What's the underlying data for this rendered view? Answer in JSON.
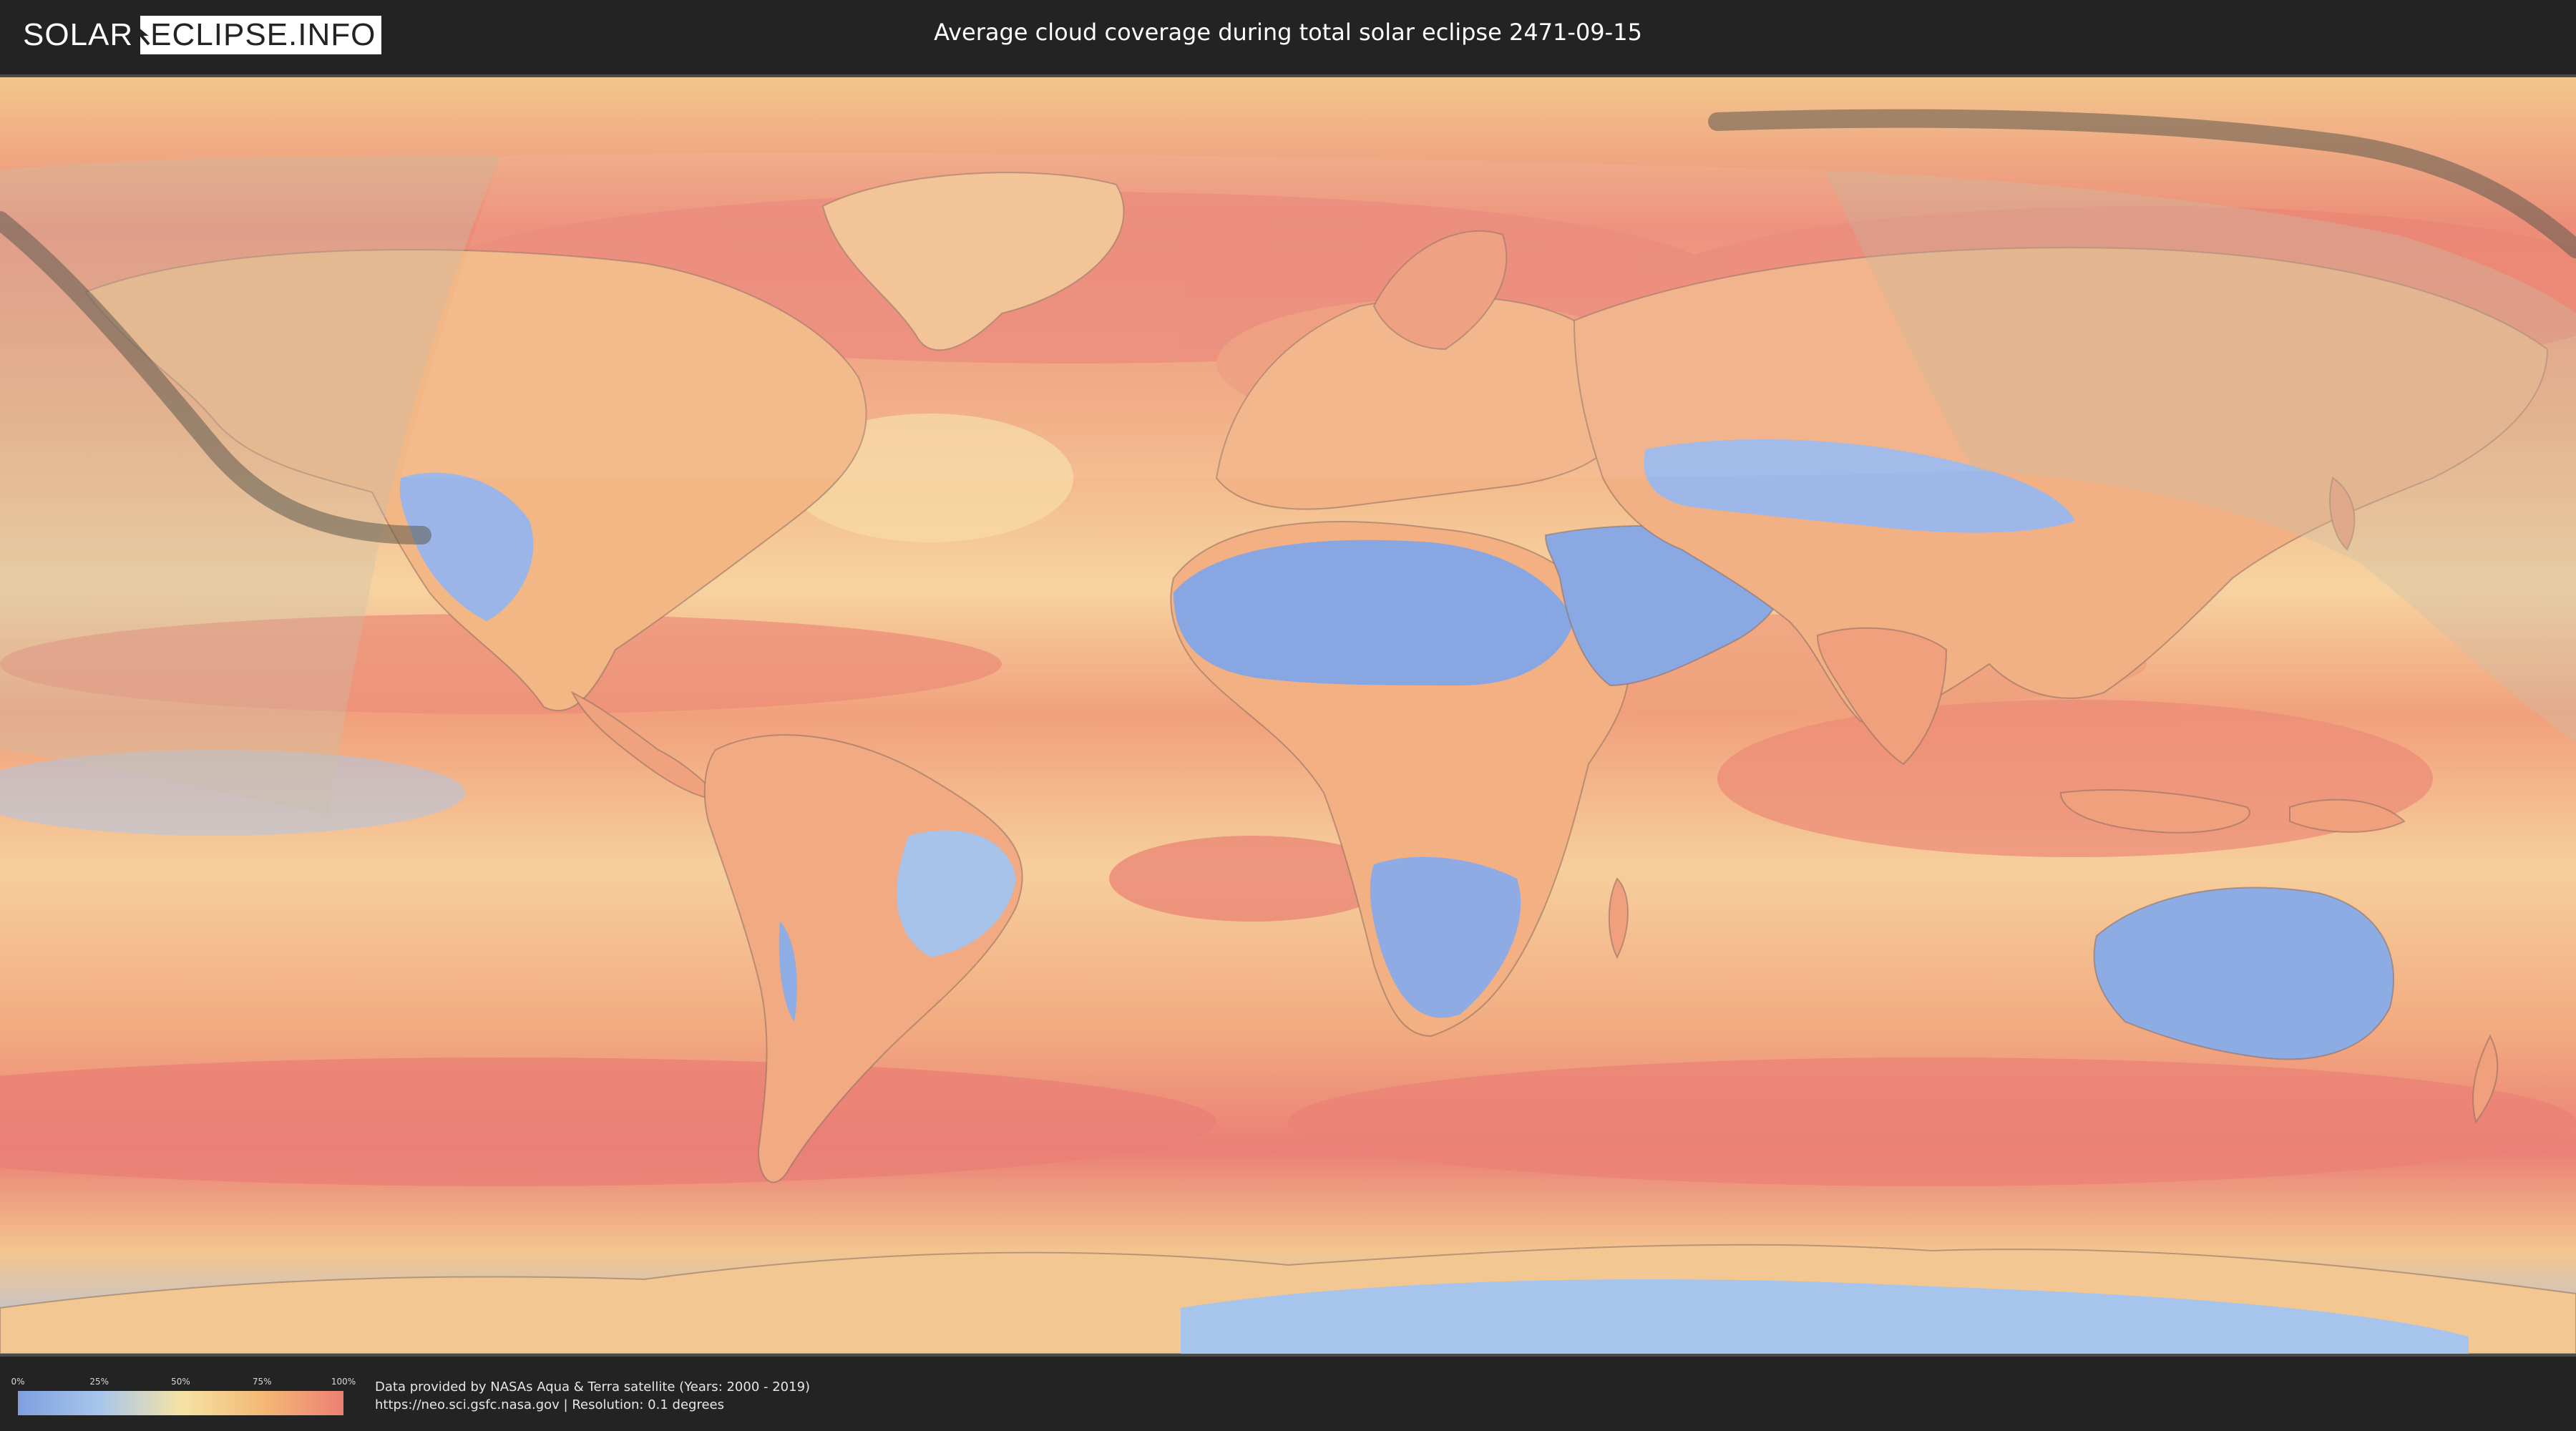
{
  "header": {
    "logo_left": "SOLAR",
    "logo_right": "ECLIPSE.INFO",
    "title": "Average cloud coverage during total solar eclipse 2471-09-15"
  },
  "map": {
    "colors": {
      "clear": "#7f9fe0",
      "low": "#a7c6ec",
      "mid": "#f5e3a6",
      "high": "#f4b975",
      "overcast": "#ec8074",
      "eclipse_path": "#5e5a4e",
      "shadow_zone": "#c8c1a8"
    }
  },
  "legend": {
    "ticks": [
      "0%",
      "25%",
      "50%",
      "75%",
      "100%"
    ]
  },
  "footer": {
    "line1": "Data provided by NASAs Aqua & Terra satellite (Years: 2000 - 2019)",
    "line2": "https://neo.sci.gsfc.nasa.gov | Resolution: 0.1 degrees"
  }
}
